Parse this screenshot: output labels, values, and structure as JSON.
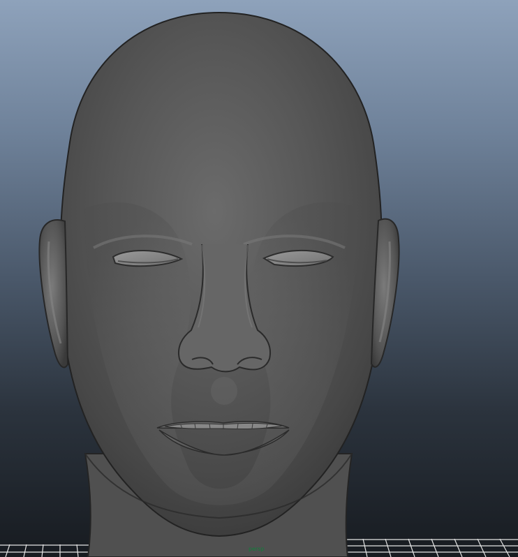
{
  "viewport": {
    "camera_label": "persp",
    "object_name": "head mesh",
    "icons": {
      "model": "head-model",
      "grid": "ground-grid"
    },
    "colors": {
      "background_top": "#8ea2bb",
      "background_bottom": "#171b20",
      "camera_label": "#0f7f3a",
      "grid": "#f0f0f0"
    }
  }
}
